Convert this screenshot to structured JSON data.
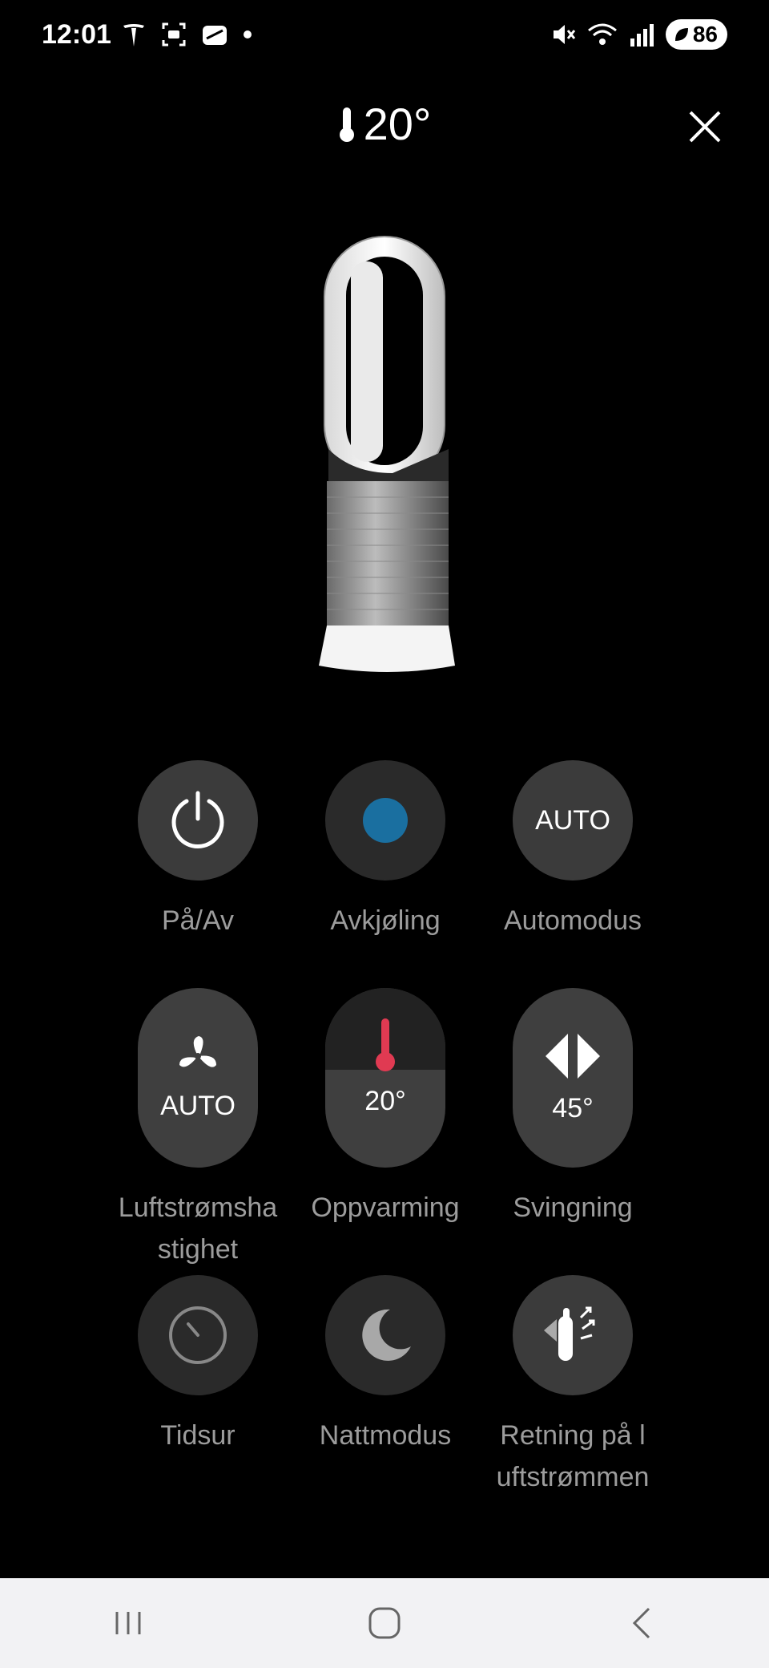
{
  "status_bar": {
    "time": "12:01",
    "left_icons": [
      "tesla-icon",
      "screenshot-icon",
      "app-icon",
      "dot-icon"
    ],
    "right_icons": [
      "mute-icon",
      "wifi-icon",
      "signal-icon"
    ],
    "battery": "86"
  },
  "header": {
    "temperature": "20°",
    "close_icon": "close-icon"
  },
  "controls": [
    {
      "id": "power",
      "label": "På/Av",
      "icon": "power-icon"
    },
    {
      "id": "cooling",
      "label": "Avkjøling",
      "icon": "blue-dot-icon",
      "accent": "#1a6fa0"
    },
    {
      "id": "auto-mode",
      "label": "Automodus",
      "value": "AUTO"
    },
    {
      "id": "airflow-speed",
      "label_line1": "Luftstrømsha",
      "label_line2": "stighet",
      "value": "AUTO",
      "icon": "fan-icon"
    },
    {
      "id": "heating",
      "label": "Oppvarming",
      "value": "20°",
      "icon": "thermometer-icon",
      "accent": "#e03a52"
    },
    {
      "id": "oscillation",
      "label": "Svingning",
      "value": "45°",
      "icon": "oscillation-icon"
    },
    {
      "id": "timer",
      "label": "Tidsur",
      "icon": "timer-icon"
    },
    {
      "id": "night-mode",
      "label": "Nattmodus",
      "icon": "moon-icon"
    },
    {
      "id": "airflow-direction",
      "label_line1": "Retning på l",
      "label_line2": "uftstrømmen",
      "icon": "airflow-direction-icon"
    }
  ],
  "nav": [
    "recent-apps-icon",
    "home-icon",
    "back-icon"
  ]
}
